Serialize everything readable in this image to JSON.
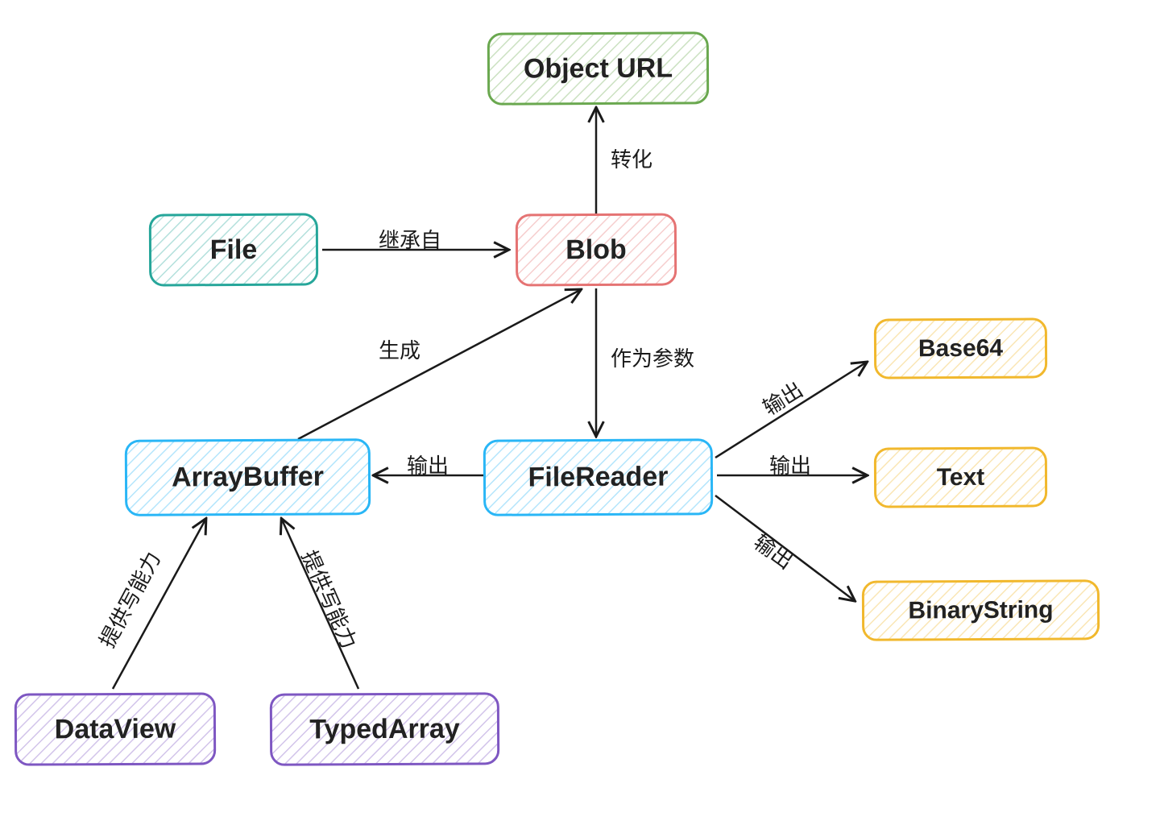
{
  "nodes": {
    "objecturl": {
      "label": "Object URL",
      "color": "#6aa84f"
    },
    "file": {
      "label": "File",
      "color": "#26a69a"
    },
    "blob": {
      "label": "Blob",
      "color": "#e57373"
    },
    "arraybuffer": {
      "label": "ArrayBuffer",
      "color": "#29b6f6"
    },
    "filereader": {
      "label": "FileReader",
      "color": "#29b6f6"
    },
    "base64": {
      "label": "Base64",
      "color": "#f1b82d"
    },
    "text": {
      "label": "Text",
      "color": "#f1b82d"
    },
    "binarystring": {
      "label": "BinaryString",
      "color": "#f1b82d"
    },
    "dataview": {
      "label": "DataView",
      "color": "#7e57c2"
    },
    "typedarray": {
      "label": "TypedArray",
      "color": "#7e57c2"
    }
  },
  "edges": {
    "file_blob": {
      "label": "继承自"
    },
    "blob_objecturl": {
      "label": "转化"
    },
    "blob_filereader": {
      "label": "作为参数"
    },
    "arraybuffer_blob": {
      "label": "生成"
    },
    "filereader_arraybuffer": {
      "label": "输出"
    },
    "filereader_base64": {
      "label": "输出"
    },
    "filereader_text": {
      "label": "输出"
    },
    "filereader_binarystring": {
      "label": "输出"
    },
    "dataview_arraybuffer": {
      "label": "提供写能力"
    },
    "typedarray_arraybuffer": {
      "label": "提供写能力"
    }
  }
}
